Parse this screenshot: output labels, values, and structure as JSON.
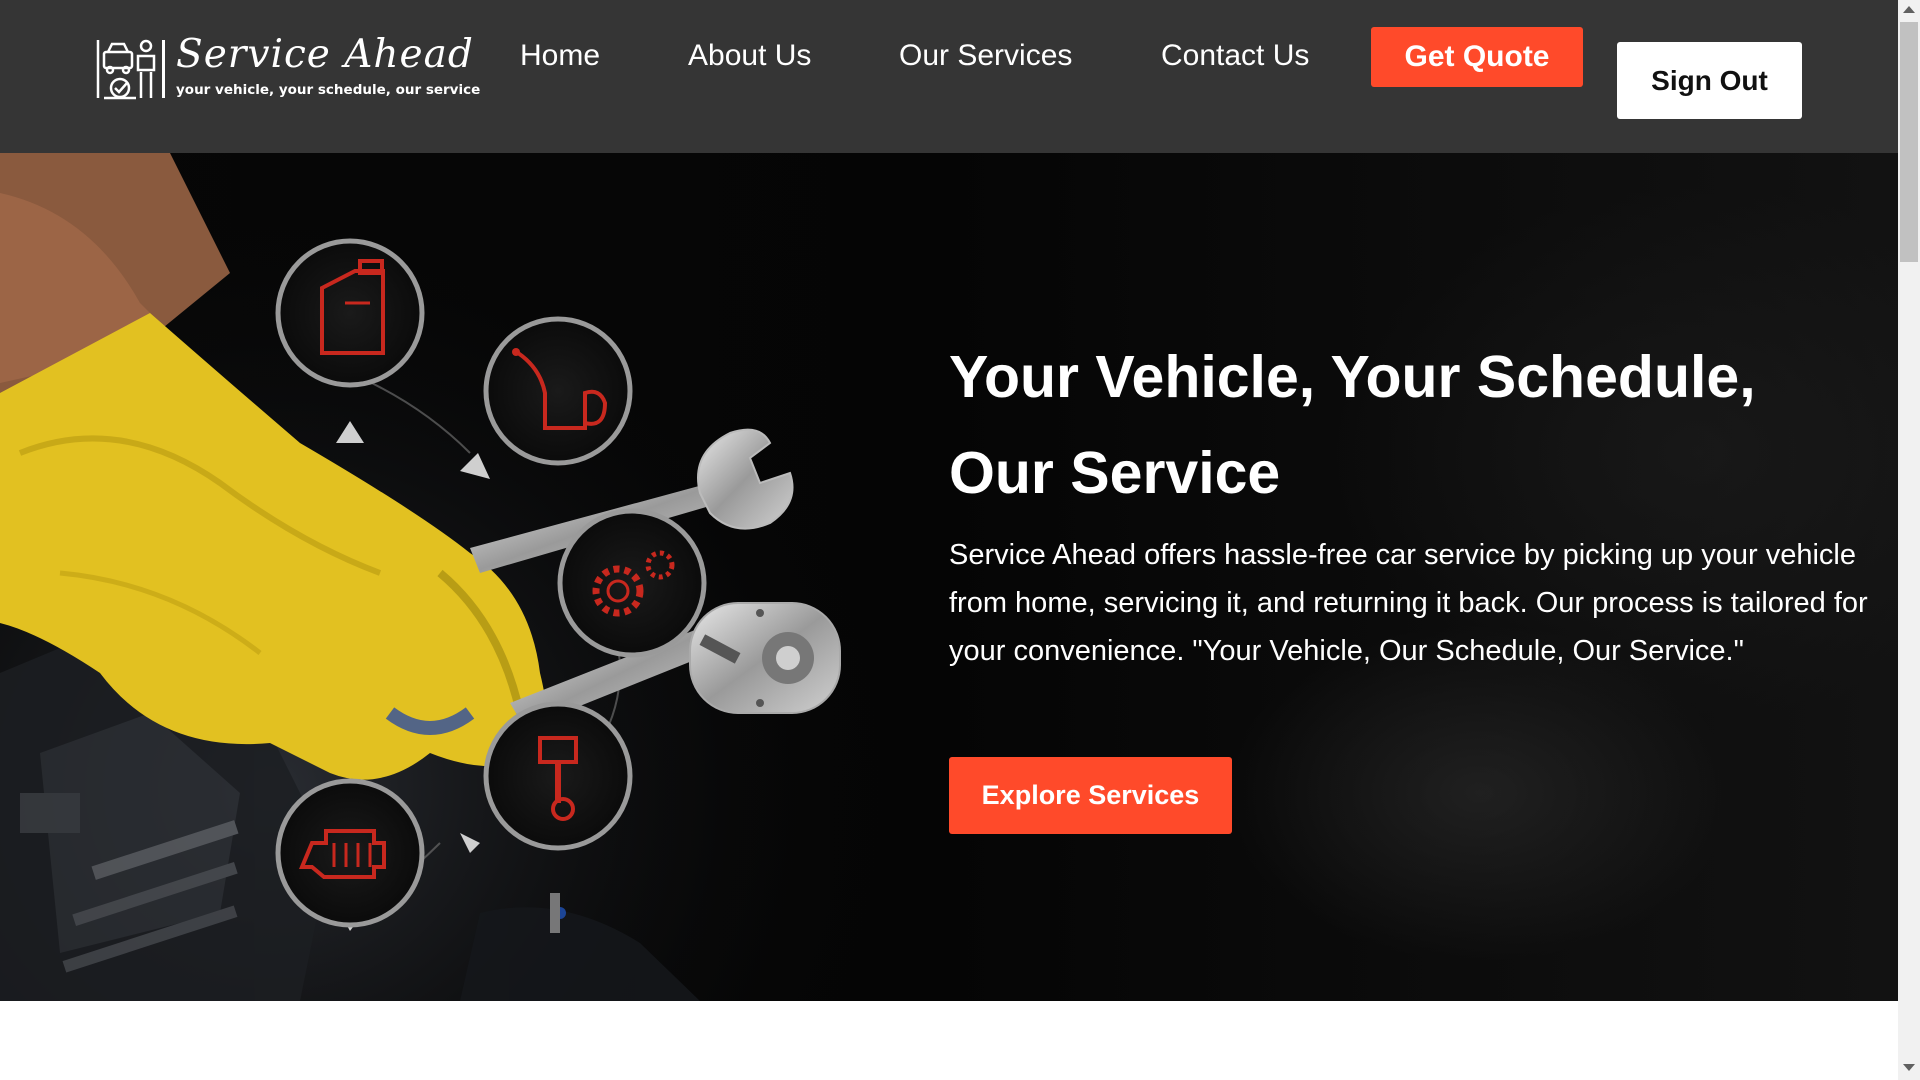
{
  "brand": {
    "name": "Service Ahead",
    "tagline": "your vehicle, your schedule, our service"
  },
  "nav": {
    "links": [
      "Home",
      "About Us",
      "Our Services",
      "Contact Us"
    ],
    "quote_label": "Get Quote",
    "signout_label": "Sign Out"
  },
  "hero": {
    "title": "Your Vehicle, Your Schedule, Our Service",
    "description": "Service Ahead offers hassle-free car service by picking up your vehicle from home, servicing it, and returning it back. Our process is tailored for your convenience. \"Your Vehicle, Our Schedule, Our Service.\"",
    "cta_label": "Explore Services",
    "icons": [
      "oil-can-icon",
      "oil-pitcher-icon",
      "gears-icon",
      "piston-icon",
      "engine-icon"
    ]
  },
  "colors": {
    "navbar_bg": "#353535",
    "accent": "#ff4a2a",
    "hero_bg": "#070707",
    "icon_red": "#c8281e",
    "glove_yellow": "#e2c121"
  }
}
